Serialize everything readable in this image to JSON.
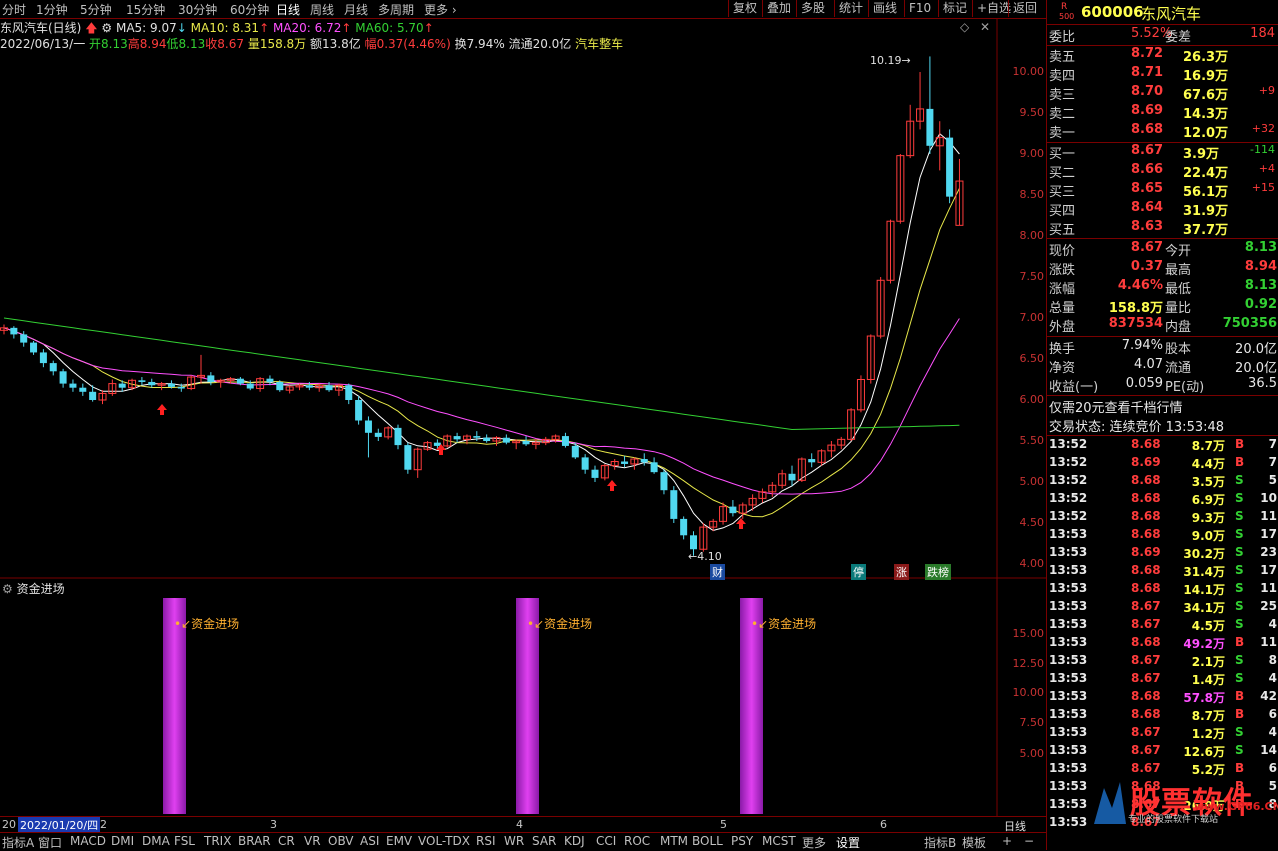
{
  "toolbar": {
    "periods": [
      "分时",
      "1分钟",
      "5分钟",
      "15分钟",
      "30分钟",
      "60分钟",
      "日线",
      "周线",
      "月线",
      "多周期",
      "更多"
    ],
    "right_buttons": [
      "复权",
      "叠加",
      "多股",
      "统计",
      "画线",
      "F10",
      "标记",
      "+自选",
      "返回"
    ]
  },
  "chart_header": {
    "name": "东风汽车(日线)",
    "ma5": "MA5: 9.07",
    "ma10": "MA10: 8.31",
    "ma20": "MA20: 6.72",
    "ma60": "MA60: 5.70",
    "date": "2022/06/13/一",
    "open": "开8.13",
    "high": "高8.94",
    "low": "低8.13",
    "close": "收8.67",
    "volume": "量158.8万",
    "amount": "额13.8亿",
    "change": "幅0.37(4.46%)",
    "turnover": "换7.94%",
    "float": "流通20.0亿",
    "sector": "汽车整车"
  },
  "price_axis": [
    "10.00",
    "9.50",
    "9.00",
    "8.50",
    "8.00",
    "7.50",
    "7.00",
    "6.50",
    "6.00",
    "5.50",
    "5.00",
    "4.50",
    "4.00"
  ],
  "annotations": {
    "high": "10.19",
    "low": "4.10",
    "badge1": "财",
    "badge2": "停",
    "badge3": "涨",
    "badge4": "跌榜"
  },
  "indicator": {
    "title": "资金进场",
    "label": "资金进场",
    "axis": [
      "15.00",
      "12.50",
      "10.00",
      "7.50",
      "5.00"
    ]
  },
  "time_axis": {
    "start": "20",
    "date_box": "2022/01/20/四",
    "months": [
      "2",
      "3",
      "4",
      "5",
      "6"
    ],
    "period": "日线"
  },
  "bottom_tabs": [
    "指标A",
    "窗口",
    "MACD",
    "DMI",
    "DMA",
    "FSL",
    "TRIX",
    "BRAR",
    "CR",
    "VR",
    "OBV",
    "ASI",
    "EMV",
    "VOL-TDX",
    "RSI",
    "WR",
    "SAR",
    "KDJ",
    "CCI",
    "ROC",
    "MTM",
    "BOLL",
    "PSY",
    "MCST",
    "更多",
    "设置"
  ],
  "bottom_right": [
    "指标B",
    "模板",
    "+",
    "−"
  ],
  "stock": {
    "code": "600006",
    "name": "东风汽车",
    "badge_r": "R",
    "badge_num": "500"
  },
  "wei": {
    "bi_label": "委比",
    "bi": "5.52%",
    "cha_label": "委差",
    "cha": "184"
  },
  "sells": [
    {
      "label": "卖五",
      "price": "8.72",
      "vol": "26.3万",
      "chg": ""
    },
    {
      "label": "卖四",
      "price": "8.71",
      "vol": "16.9万",
      "chg": ""
    },
    {
      "label": "卖三",
      "price": "8.70",
      "vol": "67.6万",
      "chg": "+9"
    },
    {
      "label": "卖二",
      "price": "8.69",
      "vol": "14.3万",
      "chg": ""
    },
    {
      "label": "卖一",
      "price": "8.68",
      "vol": "12.0万",
      "chg": "+32"
    }
  ],
  "buys": [
    {
      "label": "买一",
      "price": "8.67",
      "vol": "3.9万",
      "chg": "-114"
    },
    {
      "label": "买二",
      "price": "8.66",
      "vol": "22.4万",
      "chg": "+4"
    },
    {
      "label": "买三",
      "price": "8.65",
      "vol": "56.1万",
      "chg": "+15"
    },
    {
      "label": "买四",
      "price": "8.64",
      "vol": "31.9万",
      "chg": ""
    },
    {
      "label": "买五",
      "price": "8.63",
      "vol": "37.7万",
      "chg": ""
    }
  ],
  "quote": [
    {
      "l1": "现价",
      "v1": "8.67",
      "l2": "今开",
      "v2": "8.13"
    },
    {
      "l1": "涨跌",
      "v1": "0.37",
      "l2": "最高",
      "v2": "8.94"
    },
    {
      "l1": "涨幅",
      "v1": "4.46%",
      "l2": "最低",
      "v2": "8.13"
    },
    {
      "l1": "总量",
      "v1": "158.8万",
      "l2": "量比",
      "v2": "0.92"
    },
    {
      "l1": "外盘",
      "v1": "837534",
      "l2": "内盘",
      "v2": "750356"
    }
  ],
  "quote2": [
    {
      "l1": "换手",
      "v1": "7.94%",
      "l2": "股本",
      "v2": "20.0亿"
    },
    {
      "l1": "净资",
      "v1": "4.07",
      "l2": "流通",
      "v2": "20.0亿"
    },
    {
      "l1": "收益(一)",
      "v1": "0.059",
      "l2": "PE(动)",
      "v2": "36.5"
    }
  ],
  "promo": "仅需20元查看千档行情",
  "trade_status": "交易状态: 连续竞价 13:53:48",
  "trades": [
    {
      "t": "13:52",
      "p": "8.68",
      "v": "8.7万",
      "d": "B",
      "n": "7"
    },
    {
      "t": "13:52",
      "p": "8.69",
      "v": "4.4万",
      "d": "B",
      "n": "7"
    },
    {
      "t": "13:52",
      "p": "8.68",
      "v": "3.5万",
      "d": "S",
      "n": "5"
    },
    {
      "t": "13:52",
      "p": "8.68",
      "v": "6.9万",
      "d": "S",
      "n": "10"
    },
    {
      "t": "13:52",
      "p": "8.68",
      "v": "9.3万",
      "d": "S",
      "n": "11"
    },
    {
      "t": "13:53",
      "p": "8.68",
      "v": "9.0万",
      "d": "S",
      "n": "17"
    },
    {
      "t": "13:53",
      "p": "8.69",
      "v": "30.2万",
      "d": "S",
      "n": "23"
    },
    {
      "t": "13:53",
      "p": "8.68",
      "v": "31.4万",
      "d": "S",
      "n": "17"
    },
    {
      "t": "13:53",
      "p": "8.68",
      "v": "14.1万",
      "d": "S",
      "n": "11"
    },
    {
      "t": "13:53",
      "p": "8.67",
      "v": "34.1万",
      "d": "S",
      "n": "25"
    },
    {
      "t": "13:53",
      "p": "8.67",
      "v": "4.5万",
      "d": "S",
      "n": "4"
    },
    {
      "t": "13:53",
      "p": "8.68",
      "v": "49.2万",
      "d": "B",
      "n": "11"
    },
    {
      "t": "13:53",
      "p": "8.67",
      "v": "2.1万",
      "d": "S",
      "n": "8"
    },
    {
      "t": "13:53",
      "p": "8.67",
      "v": "1.4万",
      "d": "S",
      "n": "4"
    },
    {
      "t": "13:53",
      "p": "8.68",
      "v": "57.8万",
      "d": "B",
      "n": "42"
    },
    {
      "t": "13:53",
      "p": "8.68",
      "v": "8.7万",
      "d": "B",
      "n": "6"
    },
    {
      "t": "13:53",
      "p": "8.67",
      "v": "1.2万",
      "d": "S",
      "n": "4"
    },
    {
      "t": "13:53",
      "p": "8.67",
      "v": "12.6万",
      "d": "S",
      "n": "14"
    },
    {
      "t": "13:53",
      "p": "8.67",
      "v": "5.2万",
      "d": "B",
      "n": "6"
    },
    {
      "t": "13:53",
      "p": "8.68",
      "v": "",
      "d": "B",
      "n": "5"
    },
    {
      "t": "13:53",
      "p": "8.67",
      "v": "26.9万",
      "d": "B",
      "n": "8"
    },
    {
      "t": "13:53",
      "p": "8.67",
      "v": "",
      "d": "",
      "n": ""
    }
  ],
  "watermark": {
    "brand": "股票软件",
    "url": "www.GP66.CN",
    "tag": "专业的股票软件下载站"
  },
  "colors": {
    "up": "#ff3c3c",
    "down": "#50d8f0",
    "ma5": "#ffffff",
    "ma10": "#e8e84a",
    "ma20": "#ff50ff",
    "ma60": "#33d033",
    "bar": "#c030d0"
  }
}
